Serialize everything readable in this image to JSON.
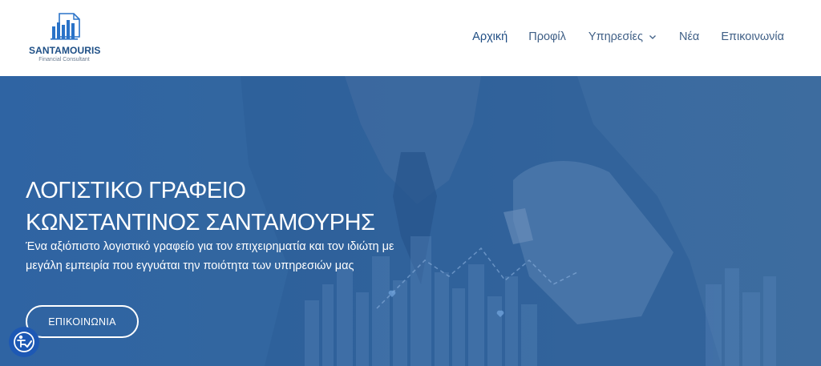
{
  "brand": {
    "name": "SANTAMOURIS",
    "tagline": "Financial Consultant",
    "color": "#1e4f86"
  },
  "nav": {
    "items": [
      {
        "label": "Αρχική",
        "active": true
      },
      {
        "label": "Προφίλ"
      },
      {
        "label": "Υπηρεσίες",
        "has_dropdown": true
      },
      {
        "label": "Νέα"
      },
      {
        "label": "Επικοινωνία"
      }
    ]
  },
  "hero": {
    "title_line1": "ΛΟΓΙΣΤΙΚΟ ΓΡΑΦΕΙΟ",
    "title_line2": "ΚΩΝΣΤΑΝΤΙΝΟΣ ΣΑΝΤΑΜΟΥΡΗΣ",
    "description_line1": "Ένα αξιόπιστο λογιστικό γραφείο για τον επιχειρηματία και τον ιδιώτη με",
    "description_line2": "μεγάλη εμπειρία που εγγυάται την ποιότητα των υπηρεσιών μας",
    "cta_label": "ΕΠΙΚΟΙΝΩΝΙΑ",
    "overlay_color": "#2f64a3"
  },
  "accessibility": {
    "icon": "accessibility-icon",
    "color": "#1d58b4"
  }
}
